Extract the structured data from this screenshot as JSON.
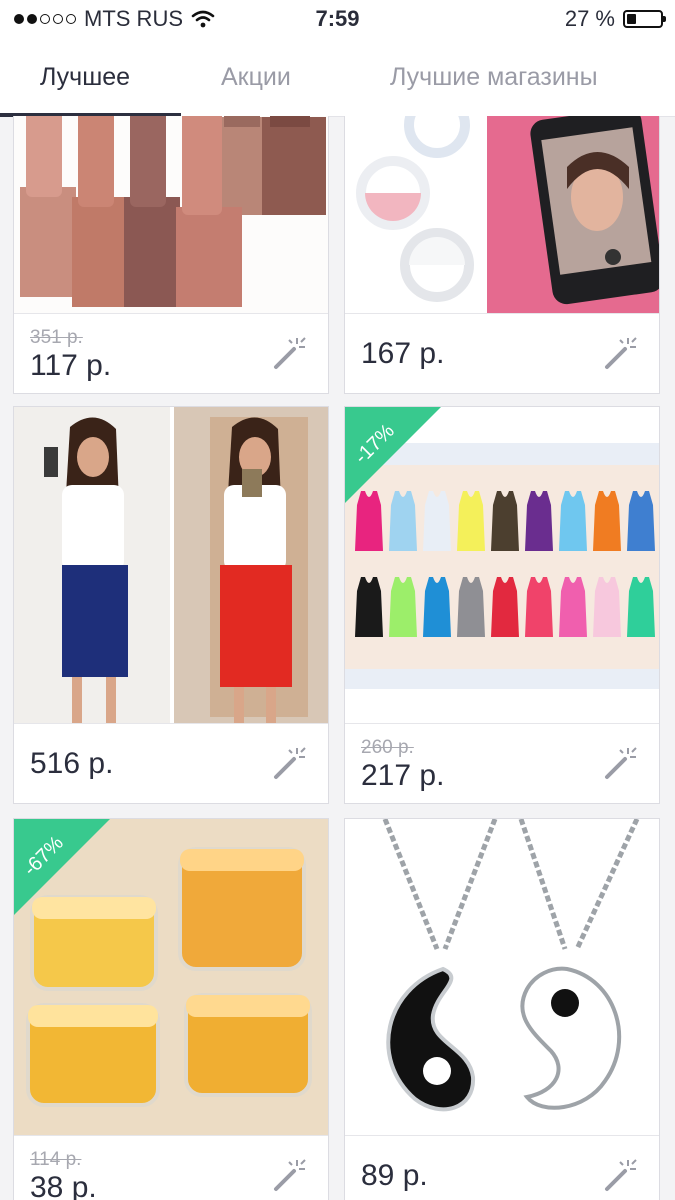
{
  "status_bar": {
    "carrier": "MTS RUS",
    "time": "7:59",
    "battery": "27 %",
    "battery_level": 0.27
  },
  "tabs": [
    {
      "label": "Лучшее",
      "active": true
    },
    {
      "label": "Акции",
      "active": false
    },
    {
      "label": "Лучшие магазины",
      "active": false
    }
  ],
  "products": [
    {
      "old_price": "351 р.",
      "price": "117 р.",
      "image": "lipsticks-photo"
    },
    {
      "old_price": "",
      "price": "167 р.",
      "image": "selfie-ring-light-photo"
    },
    {
      "old_price": "",
      "price": "516 р.",
      "image": "pencil-skirt-photo"
    },
    {
      "old_price": "260 р.",
      "price": "217 р.",
      "discount": "-17%",
      "image": "tank-tops-photo"
    },
    {
      "old_price": "114 р.",
      "price": "38 р.",
      "discount": "-67%",
      "image": "cosmetic-jars-photo"
    },
    {
      "old_price": "",
      "price": "89 р.",
      "image": "yin-yang-necklace-photo"
    }
  ],
  "colors": {
    "discount_badge": "#38c98e",
    "active_tab": "#2b2e3d",
    "inactive_tab": "#9a9ba6"
  }
}
